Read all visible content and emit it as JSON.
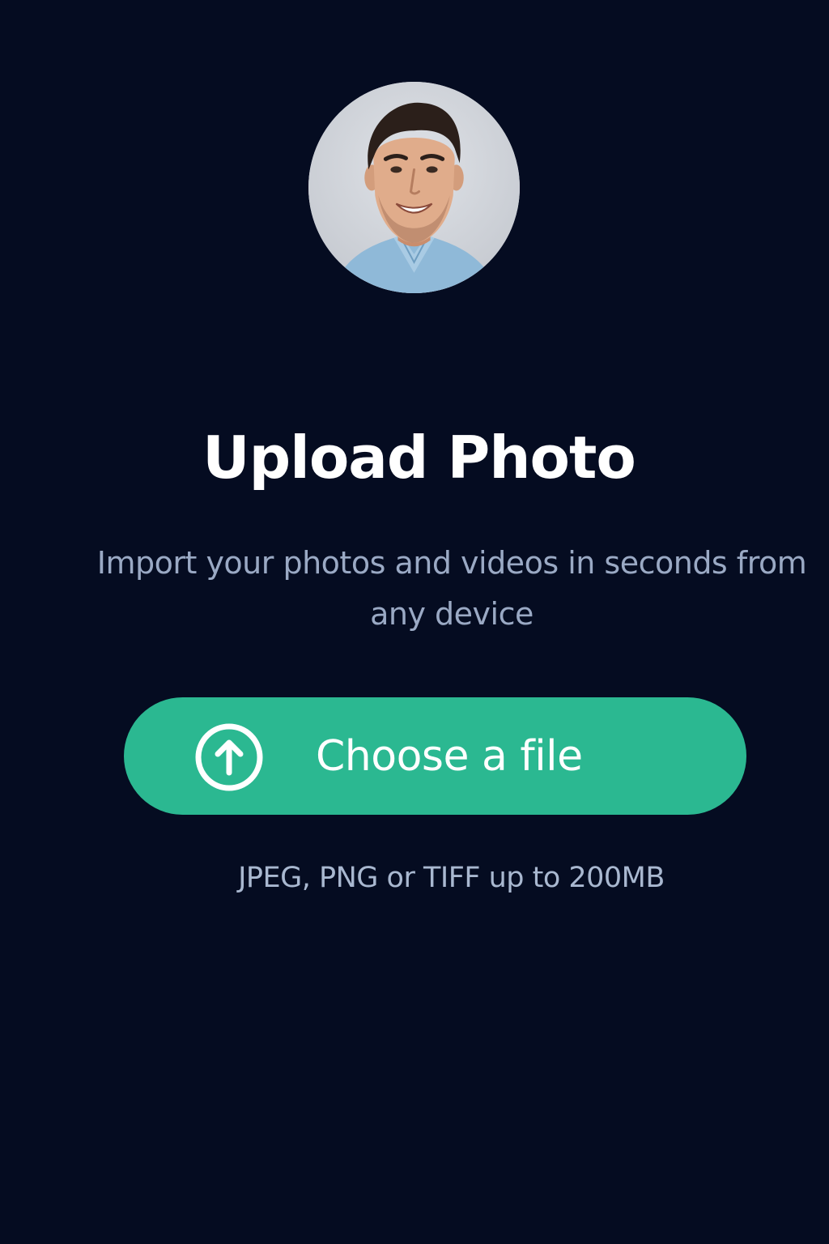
{
  "avatar": {
    "alt": "Profile photo of a smiling man in a light blue shirt"
  },
  "header": {
    "title": "Upload Photo",
    "subtitle": "Import your photos and videos in seconds from any device"
  },
  "upload_button": {
    "label": "Choose a file",
    "icon": "upload-arrow-circle-icon"
  },
  "hint": {
    "text": "JPEG, PNG or TIFF up to 200MB"
  },
  "colors": {
    "background": "#050c21",
    "accent": "#2bb891",
    "title": "#ffffff",
    "subtitle": "#9aa9c4"
  }
}
